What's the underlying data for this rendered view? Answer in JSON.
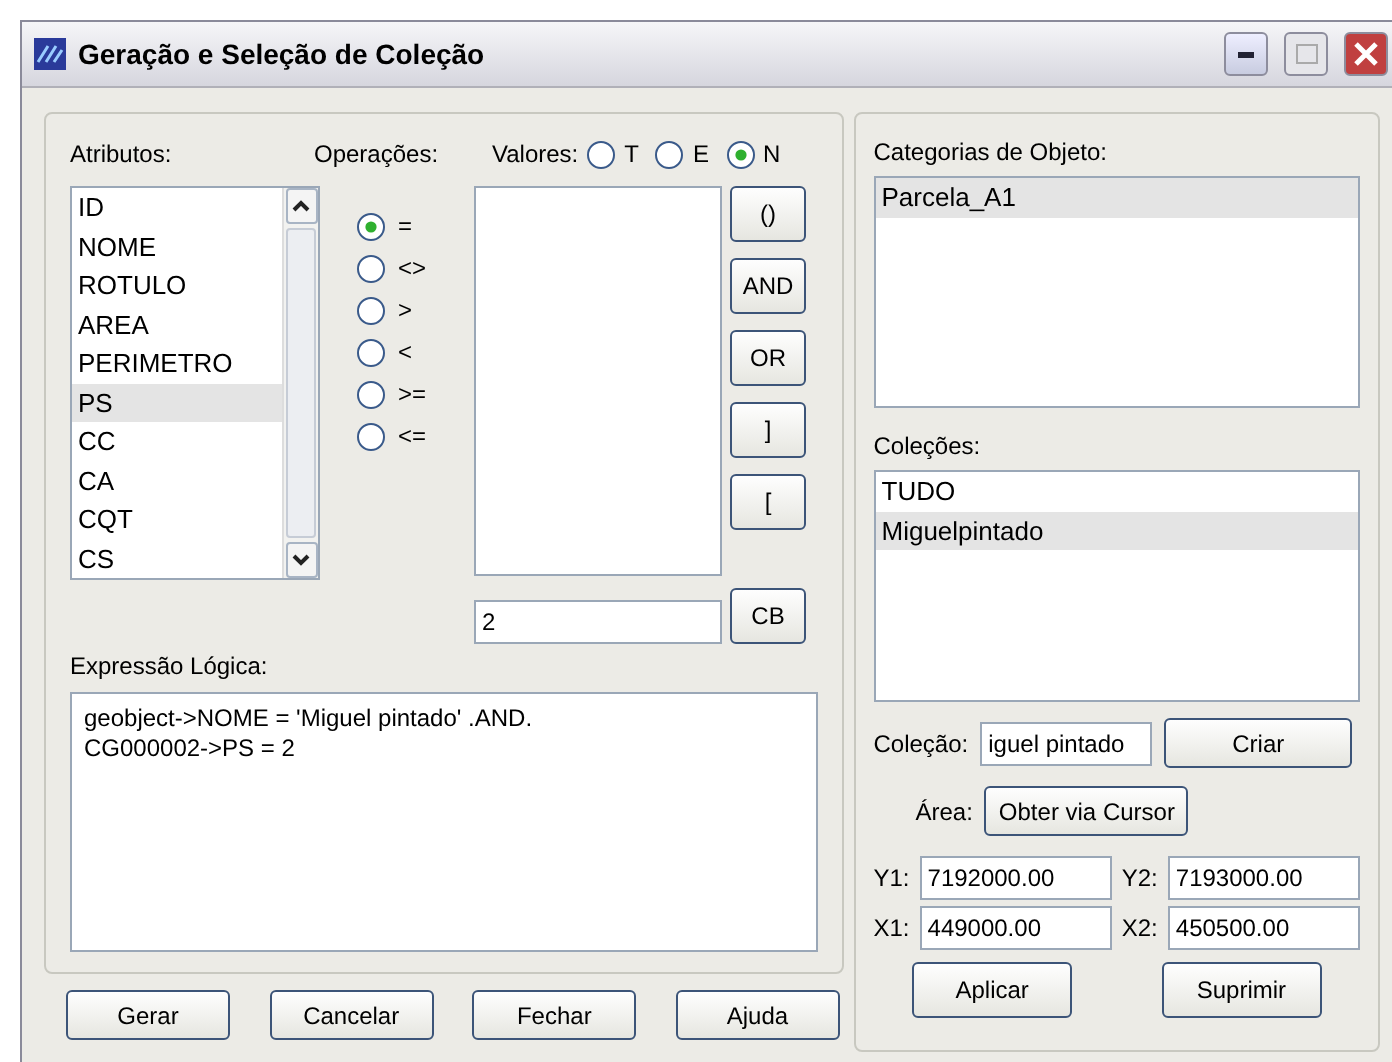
{
  "window": {
    "title": "Geração e Seleção de Coleção"
  },
  "attributes": {
    "label": "Atributos:",
    "items": [
      {
        "text": "ID",
        "selected": false
      },
      {
        "text": "NOME",
        "selected": false
      },
      {
        "text": "ROTULO",
        "selected": false
      },
      {
        "text": "AREA",
        "selected": false
      },
      {
        "text": "PERIMETRO",
        "selected": false
      },
      {
        "text": "PS",
        "selected": true
      },
      {
        "text": "CC",
        "selected": false
      },
      {
        "text": "CA",
        "selected": false
      },
      {
        "text": "CQT",
        "selected": false
      },
      {
        "text": "CS",
        "selected": false
      }
    ]
  },
  "operations": {
    "label": "Operações:",
    "options": [
      {
        "text": "=",
        "selected": true
      },
      {
        "text": "<>",
        "selected": false
      },
      {
        "text": ">",
        "selected": false
      },
      {
        "text": "<",
        "selected": false
      },
      {
        "text": ">=",
        "selected": false
      },
      {
        "text": "<=",
        "selected": false
      }
    ]
  },
  "values": {
    "label": "Valores:",
    "modes": [
      {
        "text": "T",
        "selected": false
      },
      {
        "text": "E",
        "selected": false
      },
      {
        "text": "N",
        "selected": true
      }
    ],
    "input_value": "2"
  },
  "operators": [
    {
      "label": "()"
    },
    {
      "label": "AND"
    },
    {
      "label": "OR"
    },
    {
      "label": "]"
    },
    {
      "label": "["
    }
  ],
  "cb_button": {
    "label": "CB"
  },
  "expression": {
    "label": "Expressão Lógica:",
    "text": "geobject->NOME = 'Miguel pintado' .AND.\nCG000002->PS = 2"
  },
  "buttons": [
    {
      "label": "Gerar"
    },
    {
      "label": "Cancelar"
    },
    {
      "label": "Fechar"
    },
    {
      "label": "Ajuda"
    }
  ],
  "categories": {
    "label": "Categorias de Objeto:",
    "items": [
      {
        "text": "Parcela_A1",
        "selected": true
      }
    ]
  },
  "collections": {
    "label": "Coleções:",
    "items": [
      {
        "text": "TUDO",
        "selected": false
      },
      {
        "text": "Miguelpintado",
        "selected": true
      }
    ]
  },
  "collection_field": {
    "label": "Coleção:",
    "value": "iguel pintado"
  },
  "create_button": {
    "label": "Criar"
  },
  "area": {
    "label": "Área:",
    "button": "Obter via Cursor"
  },
  "coordinates": [
    {
      "label": "Y1:",
      "value": "7192000.00"
    },
    {
      "label": "Y2:",
      "value": "7193000.00"
    },
    {
      "label": "X1:",
      "value": "449000.00"
    },
    {
      "label": "X2:",
      "value": "450500.00"
    }
  ],
  "actions": [
    {
      "label": "Aplicar"
    },
    {
      "label": "Suprimir"
    }
  ]
}
